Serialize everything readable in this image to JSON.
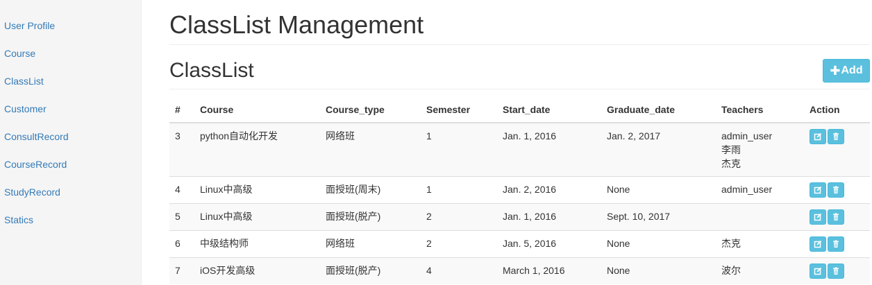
{
  "sidebar": {
    "items": [
      {
        "label": "User Profile"
      },
      {
        "label": "Course"
      },
      {
        "label": "ClassList"
      },
      {
        "label": "Customer"
      },
      {
        "label": "ConsultRecord"
      },
      {
        "label": "CourseRecord"
      },
      {
        "label": "StudyRecord"
      },
      {
        "label": "Statics"
      }
    ]
  },
  "header": {
    "title": "ClassList Management"
  },
  "section": {
    "title": "ClassList",
    "add_label": "Add",
    "add_icon": "plus-icon"
  },
  "colors": {
    "accent": "#5bc0de",
    "link": "#337ab7"
  },
  "table": {
    "headers": [
      "#",
      "Course",
      "Course_type",
      "Semester",
      "Start_date",
      "Graduate_date",
      "Teachers",
      "Action"
    ],
    "rows": [
      {
        "id": "3",
        "course": "python自动化开发",
        "course_type": "网络班",
        "semester": "1",
        "start_date": "Jan. 1, 2016",
        "graduate_date": "Jan. 2, 2017",
        "teachers": [
          "admin_user",
          "李雨",
          "杰克"
        ]
      },
      {
        "id": "4",
        "course": "Linux中高级",
        "course_type": "面授班(周末)",
        "semester": "1",
        "start_date": "Jan. 2, 2016",
        "graduate_date": "None",
        "teachers": [
          "admin_user"
        ]
      },
      {
        "id": "5",
        "course": "Linux中高级",
        "course_type": "面授班(脱产)",
        "semester": "2",
        "start_date": "Jan. 1, 2016",
        "graduate_date": "Sept. 10, 2017",
        "teachers": []
      },
      {
        "id": "6",
        "course": "中级结构师",
        "course_type": "网络班",
        "semester": "2",
        "start_date": "Jan. 5, 2016",
        "graduate_date": "None",
        "teachers": [
          "杰克"
        ]
      },
      {
        "id": "7",
        "course": "iOS开发高级",
        "course_type": "面授班(脱产)",
        "semester": "4",
        "start_date": "March 1, 2016",
        "graduate_date": "None",
        "teachers": [
          "波尔"
        ]
      }
    ],
    "action_icons": [
      "edit-icon",
      "trash-icon"
    ]
  }
}
